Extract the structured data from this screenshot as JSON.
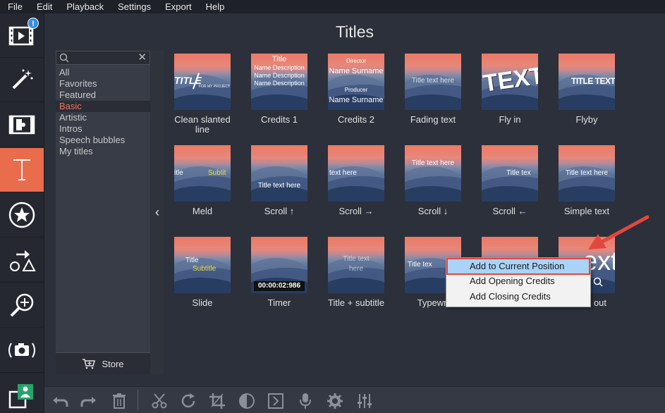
{
  "menu": [
    "File",
    "Edit",
    "Playback",
    "Settings",
    "Export",
    "Help"
  ],
  "left_tools": {
    "import_badge": "!"
  },
  "page": {
    "title": "Titles"
  },
  "categories": {
    "search_placeholder": "",
    "items": [
      "All",
      "Favorites",
      "Featured",
      "Basic",
      "Artistic",
      "Intros",
      "Speech bubbles",
      "My titles"
    ],
    "selected": "Basic",
    "store_label": "Store"
  },
  "tiles": [
    {
      "label": "Clean slanted line",
      "thumb_text": "TITLE",
      "thumb_sub": "FOR MY PROJECT"
    },
    {
      "label": "Credits 1",
      "thumb_text": "Title",
      "thumb_lines": [
        "Name Description",
        "Name Description",
        "Name Description"
      ]
    },
    {
      "label": "Credits 2",
      "thumb_role1": "Director",
      "thumb_name1": "Name Surname",
      "thumb_role2": "Producer",
      "thumb_name2": "Name Surname"
    },
    {
      "label": "Fading text",
      "thumb_text": "Title text here"
    },
    {
      "label": "Fly in",
      "thumb_text": "TEXT"
    },
    {
      "label": "Flyby",
      "thumb_text": "TITLE TEXT H"
    },
    {
      "label": "Meld",
      "thumb_text": "itle",
      "thumb_sub": "Subtit"
    },
    {
      "label": "Scroll ↑",
      "thumb_text": "Title text here"
    },
    {
      "label": "Scroll →",
      "thumb_text": "text here"
    },
    {
      "label": "Scroll ↓",
      "thumb_text": "Title text here"
    },
    {
      "label": "Scroll ←",
      "thumb_text": "Title tex"
    },
    {
      "label": "Simple text",
      "thumb_text": "Title text here"
    },
    {
      "label": "Slide",
      "thumb_text": "Title",
      "thumb_sub": "Subtitle"
    },
    {
      "label": "Timer",
      "thumb_text": "00:00:02:986"
    },
    {
      "label": "Title + subtitle",
      "thumb_text": "Title text",
      "thumb_sub": "here"
    },
    {
      "label": "Typewri",
      "thumb_text": "Title tex"
    },
    {
      "label": "",
      "thumb_text": ""
    },
    {
      "label": "out",
      "thumb_text": "ext"
    }
  ],
  "context_menu": {
    "items": [
      "Add to Current Position",
      "Add Opening Credits",
      "Add Closing Credits"
    ],
    "highlighted": "Add to Current Position"
  },
  "colors": {
    "accent": "#e96c4d",
    "selected_category": "#f0745a",
    "highlight": "#aad3f7",
    "annotation": "#e2473f"
  }
}
